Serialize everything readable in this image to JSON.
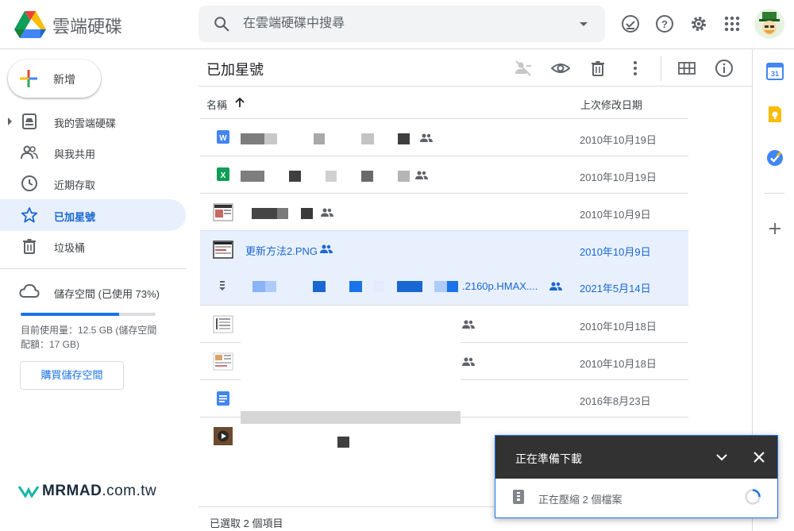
{
  "app": {
    "title": "雲端硬碟"
  },
  "search": {
    "placeholder": "在雲端硬碟中搜尋"
  },
  "left_nav": {
    "new_label": "新增",
    "items": [
      {
        "label": "我的雲端硬碟",
        "icon": "my-drive-icon"
      },
      {
        "label": "與我共用",
        "icon": "shared-with-me-icon"
      },
      {
        "label": "近期存取",
        "icon": "recent-icon"
      },
      {
        "label": "已加星號",
        "icon": "star-icon",
        "active": true
      },
      {
        "label": "垃圾桶",
        "icon": "trash-icon"
      }
    ],
    "storage_label": "儲存空間 (已使用 73%)",
    "storage_used_fraction": 0.73,
    "storage_detail": "目前使用量：12.5 GB (儲存空間配額：17 GB)",
    "buy_storage_label": "購買儲存空間"
  },
  "main": {
    "title": "已加星號",
    "columns": {
      "name": "名稱",
      "modified": "上次修改日期"
    },
    "files": [
      {
        "name": "",
        "modified": "2010年10月19日",
        "type": "word",
        "shared": true
      },
      {
        "name": "",
        "modified": "2010年10月19日",
        "type": "excel",
        "shared": true
      },
      {
        "name": "",
        "modified": "2010年10月9日",
        "type": "image",
        "shared": true
      },
      {
        "name": "更新方法2.PNG",
        "modified": "2010年10月9日",
        "type": "image",
        "shared": true,
        "selected": true
      },
      {
        "name": ".2160p.HMAX....",
        "modified": "2021年5月14日",
        "type": "archive",
        "shared": true,
        "selected": true
      },
      {
        "name": "",
        "modified": "2010年10月18日",
        "type": "image",
        "shared": true
      },
      {
        "name": "",
        "modified": "2010年10月18日",
        "type": "image",
        "shared": true
      },
      {
        "name": "",
        "modified": "2016年8月23日",
        "type": "doc",
        "shared": false
      },
      {
        "name": "",
        "modified": "",
        "type": "video",
        "shared": false
      }
    ],
    "status": "已選取 2 個項目"
  },
  "download_panel": {
    "title": "正在準備下載",
    "status": "正在壓縮 2 個檔案"
  },
  "watermark": {
    "brand": "MRMAD",
    "suffix": ".com.tw"
  },
  "colors": {
    "accent": "#1a73e8",
    "selected_bg": "#e8f0fe",
    "dark_panel": "#323232"
  }
}
